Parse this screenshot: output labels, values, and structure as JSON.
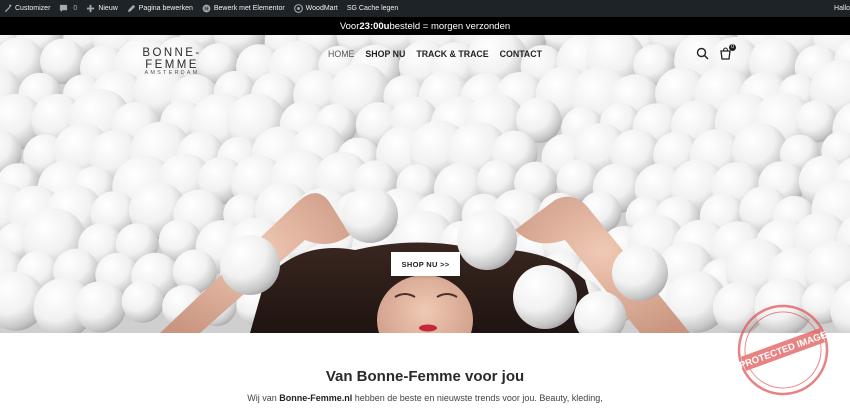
{
  "admin_bar": {
    "items": [
      {
        "icon": "palette-icon",
        "label": "Customizer"
      },
      {
        "icon": "comment-icon",
        "label": "",
        "count": "0"
      },
      {
        "icon": "plus-icon",
        "label": "Nieuw"
      },
      {
        "icon": "pencil-icon",
        "label": "Pagina bewerken"
      },
      {
        "icon": "elementor-icon",
        "label": "Bewerk met Elementor"
      },
      {
        "icon": "woodmart-icon",
        "label": "WoodMart"
      },
      {
        "icon": "",
        "label": "SG Cache legen"
      }
    ],
    "right_label": "Hallo"
  },
  "announcement": {
    "prefix": "Voor ",
    "time": "23:00u",
    "suffix": " besteld = morgen verzonden"
  },
  "header": {
    "logo_main": "BONNE-FEMME",
    "logo_sub": "AMSTERDAM",
    "nav": [
      {
        "label": "HOME",
        "active": true
      },
      {
        "label": "SHOP NU",
        "active": false
      },
      {
        "label": "TRACK & TRACE",
        "active": false
      },
      {
        "label": "CONTACT",
        "active": false
      }
    ],
    "cart_count": "0"
  },
  "hero": {
    "button_label": "SHOP NU >>"
  },
  "content": {
    "title": "Van Bonne-Femme voor jou",
    "text_prefix": "Wij van ",
    "text_brand": "Bonne-Femme.nl",
    "text_suffix": " hebben de beste en nieuwste trends voor jou. Beauty, kleding,"
  },
  "watermark": {
    "text": "PROTECTED IMAGE"
  },
  "colors": {
    "admin_bar": "#1d2327",
    "announcement": "#000000",
    "stamp": "#e05a5a"
  }
}
